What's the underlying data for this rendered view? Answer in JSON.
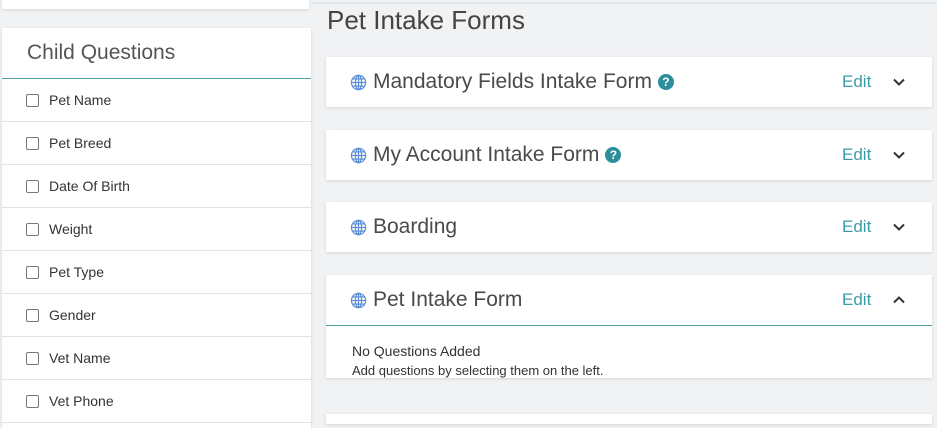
{
  "left": {
    "title": "Child Questions",
    "questions": [
      {
        "label": "Pet Name",
        "checked": false
      },
      {
        "label": "Pet Breed",
        "checked": false
      },
      {
        "label": "Date Of Birth",
        "checked": false
      },
      {
        "label": "Weight",
        "checked": false
      },
      {
        "label": "Pet Type",
        "checked": false
      },
      {
        "label": "Gender",
        "checked": false
      },
      {
        "label": "Vet Name",
        "checked": false
      },
      {
        "label": "Vet Phone",
        "checked": false
      }
    ]
  },
  "main": {
    "title": "Pet Intake Forms",
    "forms": [
      {
        "title": "Mandatory Fields Intake Form",
        "edit": "Edit",
        "help": "?",
        "expanded": false
      },
      {
        "title": "My Account Intake Form",
        "edit": "Edit",
        "help": "?",
        "expanded": false
      },
      {
        "title": "Boarding",
        "edit": "Edit",
        "expanded": false
      },
      {
        "title": "Pet Intake Form",
        "edit": "Edit",
        "expanded": true,
        "empty_title": "No Questions Added",
        "empty_sub": "Add questions by selecting them on the left."
      }
    ]
  },
  "icons": {
    "form": "globe-icon",
    "collapsed": "chevron-down-icon",
    "expanded": "chevron-up-icon",
    "help": "help-icon"
  },
  "colors": {
    "accent": "#3a9ba8",
    "help": "#2b8e9a",
    "globe": "#5b8fd6"
  }
}
